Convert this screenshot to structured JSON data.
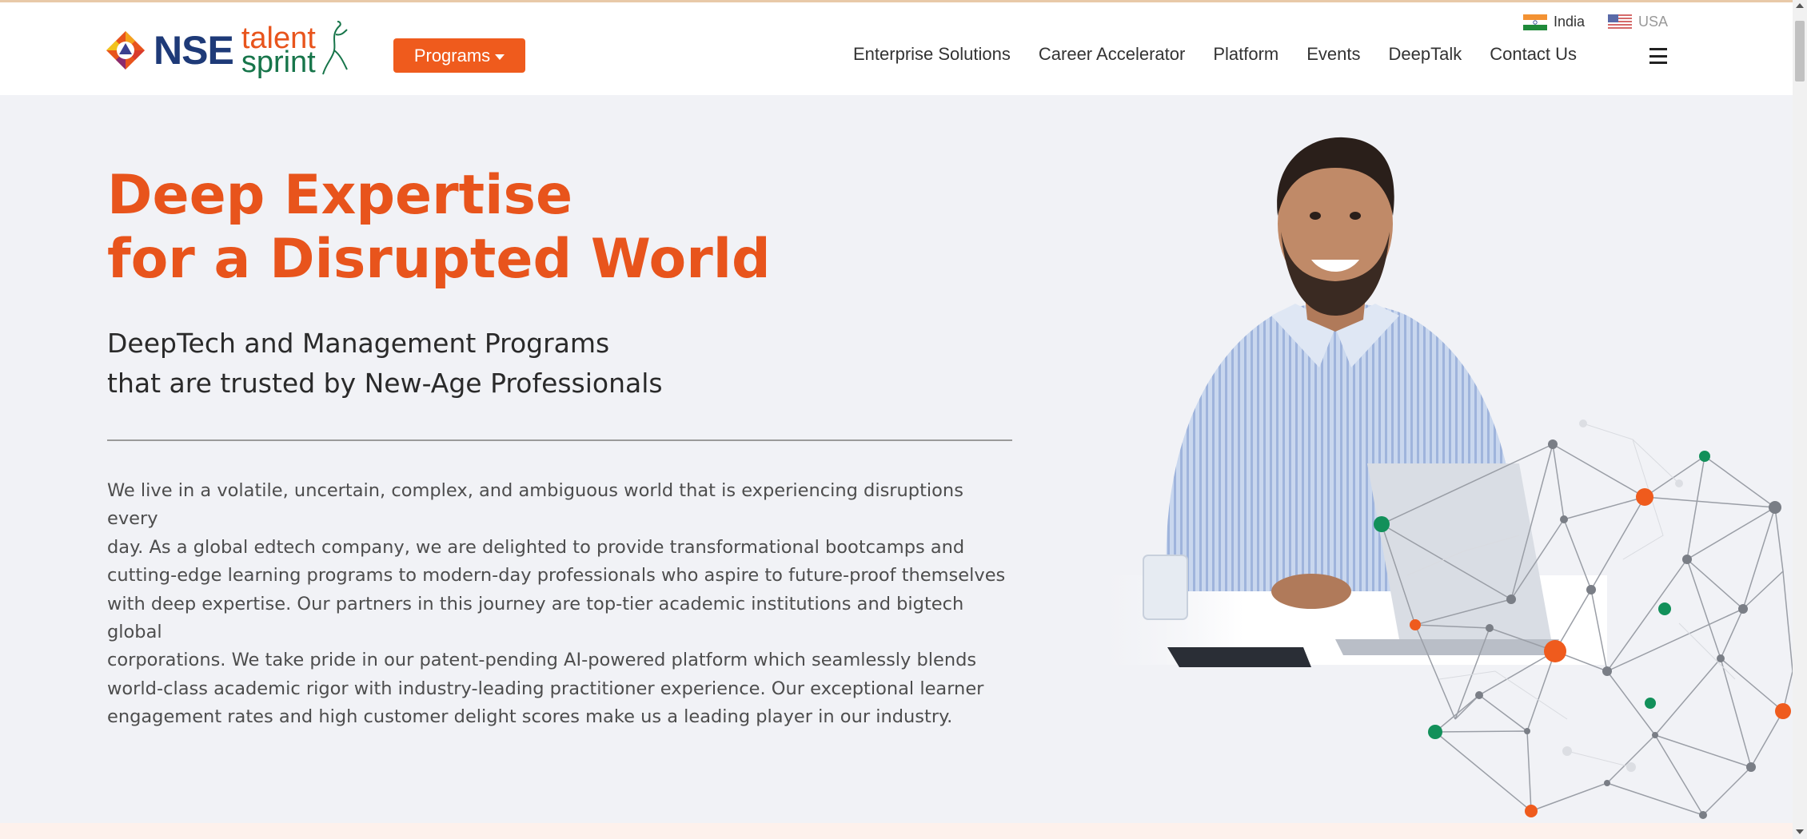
{
  "header": {
    "brand": {
      "nse": "NSE",
      "talent": "talent",
      "sprint": "sprint"
    },
    "programs_label": "Programs",
    "locales": [
      {
        "label": "India",
        "flag": "india-flag-icon"
      },
      {
        "label": "USA",
        "flag": "usa-flag-icon"
      }
    ],
    "nav": [
      {
        "label": "Enterprise Solutions"
      },
      {
        "label": "Career Accelerator"
      },
      {
        "label": "Platform"
      },
      {
        "label": "Events"
      },
      {
        "label": "DeepTalk"
      },
      {
        "label": "Contact Us"
      }
    ],
    "menu_icon": "hamburger-menu-icon"
  },
  "hero": {
    "title_line1": "Deep Expertise",
    "title_line2": "for a Disrupted World",
    "subtitle_line1": "DeepTech and Management Programs",
    "subtitle_line2": "that are trusted by New-Age Professionals",
    "body": [
      "We live in a volatile, uncertain, complex, and ambiguous world that is experiencing disruptions every",
      "day. As a global edtech company, we are delighted to provide transformational bootcamps and",
      "cutting-edge learning programs to modern-day professionals who aspire to future-proof themselves",
      "with deep expertise. Our partners in this journey are top-tier academic institutions and bigtech global",
      "corporations. We take pride in our patent-pending AI-powered platform which seamlessly blends",
      "world-class academic rigor with industry-leading practitioner experience. Our exceptional learner",
      "engagement rates and high customer delight scores make us a leading player in our industry."
    ]
  },
  "colors": {
    "accent_orange": "#e8541c",
    "button_orange": "#ef5b1d",
    "brand_navy": "#1e3a78",
    "brand_green": "#17754a",
    "hero_bg": "#f1f2f6"
  }
}
